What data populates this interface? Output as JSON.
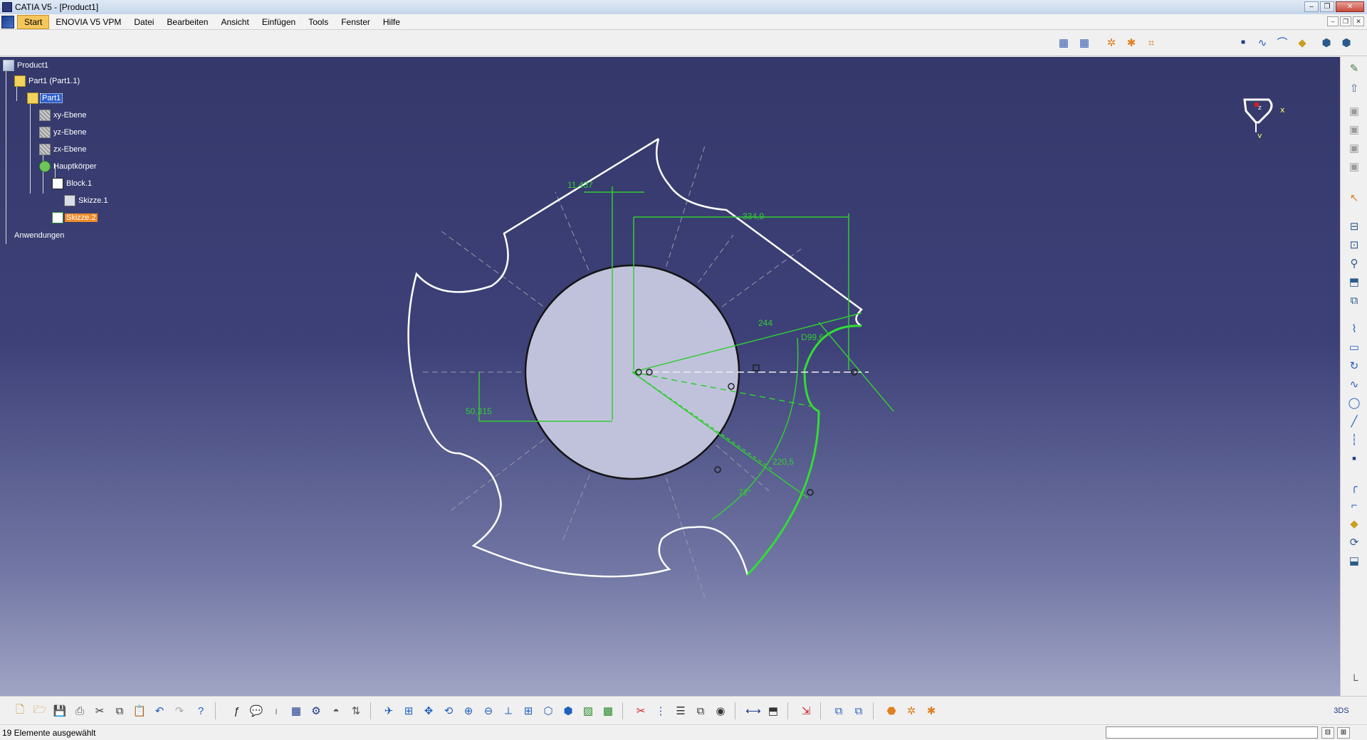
{
  "window": {
    "title": "CATIA V5 - [Product1]",
    "minimize": "–",
    "restore": "❐",
    "close": "✕"
  },
  "menubar": {
    "items": [
      "Start",
      "ENOVIA V5 VPM",
      "Datei",
      "Bearbeiten",
      "Ansicht",
      "Einfügen",
      "Tools",
      "Fenster",
      "Hilfe"
    ],
    "active_index": 0,
    "mdi_minimize": "–",
    "mdi_restore": "❐",
    "mdi_close": "✕"
  },
  "tree": {
    "nodes": [
      {
        "label": "Product1",
        "icon": "product-icon",
        "state": "normal"
      },
      {
        "label": "Part1 (Part1.1)",
        "icon": "part-instance-icon",
        "state": "normal"
      },
      {
        "label": "Part1",
        "icon": "part-icon",
        "state": "selected"
      },
      {
        "label": "xy-Ebene",
        "icon": "plane-icon",
        "state": "normal"
      },
      {
        "label": "yz-Ebene",
        "icon": "plane-icon",
        "state": "normal"
      },
      {
        "label": "zx-Ebene",
        "icon": "plane-icon",
        "state": "normal"
      },
      {
        "label": "Hauptkörper",
        "icon": "body-icon",
        "state": "normal"
      },
      {
        "label": "Block.1",
        "icon": "pad-icon",
        "state": "normal"
      },
      {
        "label": "Skizze.1",
        "icon": "sketch-icon",
        "state": "normal"
      },
      {
        "label": "Skizze.2",
        "icon": "sketch-active-icon",
        "state": "highlighted"
      },
      {
        "label": "Anwendungen",
        "icon": "",
        "state": "normal"
      }
    ]
  },
  "compass": {
    "x": "x",
    "y": "y",
    "z": "z"
  },
  "sketch": {
    "dimensions": {
      "d1": "11,437",
      "d2": "334,9",
      "d3": "244",
      "d4": "D99,6",
      "d5": "50,315",
      "d6": "220,5",
      "d7": "72°"
    }
  },
  "status": {
    "message": "19 Elemente ausgewählt",
    "command_value": ""
  },
  "colors": {
    "viewport_top": "#34386a",
    "viewport_bottom": "#a0a4c4",
    "sketch_white": "#ffffff",
    "constraint_green": "#33cc33",
    "highlight_orange": "#f08a28",
    "selection_blue": "#3060c8"
  }
}
